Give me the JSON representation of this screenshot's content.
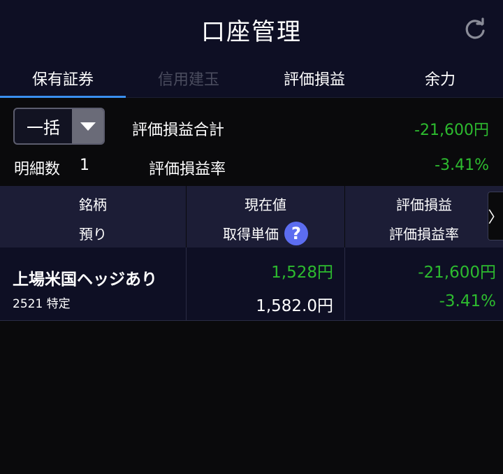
{
  "header": {
    "title": "口座管理",
    "refresh_icon": "refresh-icon"
  },
  "tabs": [
    {
      "label": "保有証券",
      "state": "active"
    },
    {
      "label": "信用建玉",
      "state": "disabled"
    },
    {
      "label": "評価損益",
      "state": "normal"
    },
    {
      "label": "余力",
      "state": "normal"
    }
  ],
  "summary": {
    "dropdown_value": "一括",
    "total_pl_label": "評価損益合計",
    "total_pl_value": "-21,600円",
    "detail_count_label": "明細数",
    "detail_count_value": "1",
    "pl_rate_label": "評価損益率",
    "pl_rate_value": "-3.41%"
  },
  "columns": {
    "col1": {
      "line1": "銘柄",
      "line2": "預り"
    },
    "col2": {
      "line1": "現在値",
      "line2": "取得単価",
      "help": "?"
    },
    "col3": {
      "line1": "評価損益",
      "line2": "評価損益率"
    },
    "scroll_glyph": "〉"
  },
  "holdings": [
    {
      "name": "上場米国ヘッジあり",
      "code_account": "2521 特定",
      "current_price": "1,528円",
      "cost_price": "1,582.0円",
      "pl": "-21,600円",
      "pl_rate": "-3.41%"
    }
  ],
  "colors": {
    "accent": "#3a8ff0",
    "positive_green": "#2dbb2f",
    "header_bg": "#0e0f24",
    "column_header_bg": "#1c1d36",
    "help_icon_bg": "#5c6df0"
  }
}
